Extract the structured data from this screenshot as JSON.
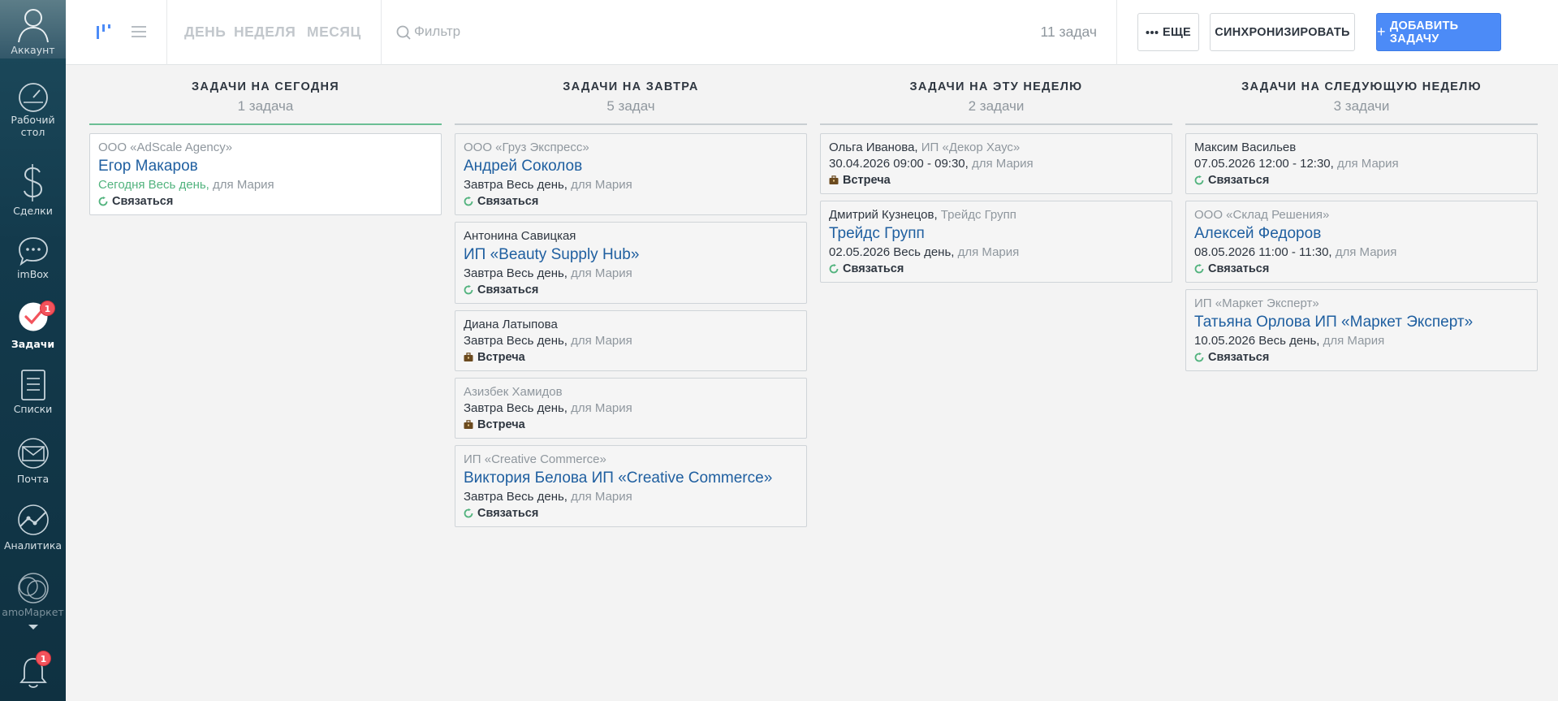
{
  "sidebar": {
    "items": [
      {
        "label": "Аккаунт"
      },
      {
        "label": "Рабочий стол"
      },
      {
        "label": "Сделки"
      },
      {
        "label": "imBox"
      },
      {
        "label": "Задачи",
        "badge": "1"
      },
      {
        "label": "Списки"
      },
      {
        "label": "Почта"
      },
      {
        "label": "Аналитика"
      },
      {
        "label": "amoМаркет"
      }
    ],
    "notifications_badge": "1"
  },
  "topbar": {
    "periods": [
      "ДЕНЬ",
      "НЕДЕЛЯ",
      "МЕСЯЦ"
    ],
    "filter_placeholder": "Фильтр",
    "task_count": "11 задач",
    "more_label": "ЕЩЕ",
    "sync_label": "СИНХРОНИЗИРОВАТЬ",
    "add_label": "ДОБАВИТЬ ЗАДАЧУ"
  },
  "columns": [
    {
      "title": "ЗАДАЧИ НА СЕГОДНЯ",
      "count": "1 задача",
      "cards": [
        {
          "top": "ООО «AdScale Agency»",
          "name": "Егор Макаров",
          "when": "Сегодня Весь день,",
          "for": " для Мария",
          "type": "Связаться"
        }
      ]
    },
    {
      "title": "ЗАДАЧИ НА ЗАВТРА",
      "count": "5 задач",
      "cards": [
        {
          "top": "ООО «Груз Экспресс»",
          "name": "Андрей Соколов",
          "when": "Завтра Весь день,",
          "for": " для Мария",
          "type": "Связаться"
        },
        {
          "top": "Антонина Савицкая",
          "name": "ИП «Beauty Supply Hub»",
          "when": "Завтра Весь день,",
          "for": " для Мария",
          "type": "Связаться"
        },
        {
          "top": "Диана Латыпова",
          "when": "Завтра Весь день,",
          "for": " для Мария",
          "type": "Встреча"
        },
        {
          "top": "Азизбек Хамидов",
          "when": "Завтра Весь день,",
          "for": " для Мария",
          "type": "Встреча"
        },
        {
          "top": "ИП «Creative Commerce»",
          "name": "Виктория Белова ИП «Creative Commerce»",
          "when": "Завтра Весь день,",
          "for": " для Мария",
          "type": "Связаться"
        }
      ]
    },
    {
      "title": "ЗАДАЧИ НА ЭТУ НЕДЕЛЮ",
      "count": "2 задачи",
      "cards": [
        {
          "top": "Ольга Иванова,",
          "top_sub": " ИП «Декор Хаус»",
          "when": "30.04.2026 09:00 - 09:30,",
          "for": " для Мария",
          "type": "Встреча"
        },
        {
          "top": "Дмитрий Кузнецов,",
          "top_sub": " Трейдс Групп",
          "name": "Трейдс Групп",
          "when": "02.05.2026 Весь день,",
          "for": " для Мария",
          "type": "Связаться"
        }
      ]
    },
    {
      "title": "ЗАДАЧИ НА СЛЕДУЮЩУЮ НЕДЕЛЮ",
      "count": "3 задачи",
      "cards": [
        {
          "top": "Максим Васильев",
          "when": "07.05.2026 12:00 - 12:30,",
          "for": " для Мария",
          "type": "Связаться"
        },
        {
          "top": "ООО «Склад Решения»",
          "name": "Алексей Федоров",
          "when": "08.05.2026 11:00 - 11:30,",
          "for": " для Мария",
          "type": "Связаться"
        },
        {
          "top": "ИП «Маркет Эксперт»",
          "name": "Татьяна Орлова ИП «Маркет Эксперт»",
          "when": "10.05.2026 Весь день,",
          "for": " для Мария",
          "type": "Связаться"
        }
      ]
    }
  ]
}
